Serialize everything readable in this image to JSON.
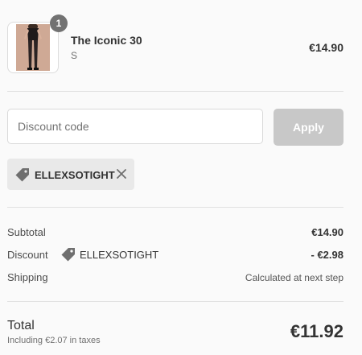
{
  "line_item": {
    "quantity": "1",
    "name": "The Iconic 30",
    "variant": "S",
    "price": "€14.90"
  },
  "discount_form": {
    "placeholder": "Discount code",
    "value": "",
    "apply_label": "Apply"
  },
  "applied_code": {
    "code": "ELLEXSOTIGHT",
    "icon": "tag-icon",
    "remove_icon": "close-icon"
  },
  "summary": {
    "subtotal_label": "Subtotal",
    "subtotal_value": "€14.90",
    "discount_label": "Discount",
    "discount_code": "ELLEXSOTIGHT",
    "discount_value": "- €2.98",
    "shipping_label": "Shipping",
    "shipping_value": "Calculated at next step"
  },
  "total": {
    "label": "Total",
    "tax_note": "Including €2.07 in taxes",
    "value": "€11.92"
  },
  "colors": {
    "background": "#fafafa",
    "apply_disabled": "#c8c8c8",
    "chip_background": "#e9e9e9",
    "badge": "#727272",
    "text": "#333333"
  }
}
